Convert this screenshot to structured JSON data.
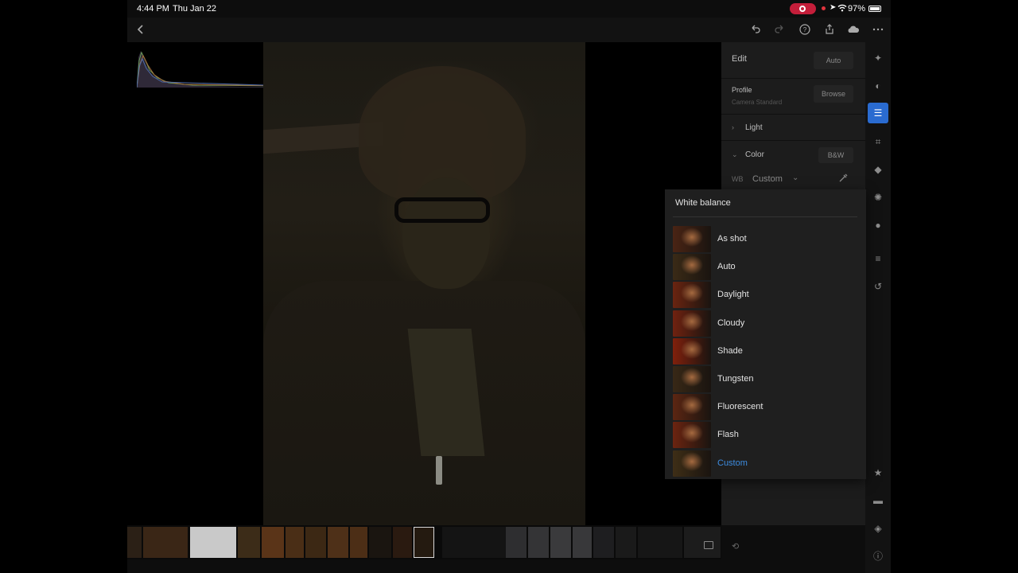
{
  "status_bar": {
    "time": "4:44 PM",
    "date": "Thu Jan 22",
    "battery": "97%"
  },
  "edit_panel": {
    "title": "Edit",
    "auto_button": "Auto",
    "profile_label": "Profile",
    "profile_value": "Camera Standard",
    "browse_button": "Browse",
    "light_label": "Light",
    "color_label": "Color",
    "bw_button": "B&W",
    "wb_label": "WB",
    "wb_value": "Custom"
  },
  "white_balance": {
    "title": "White balance",
    "options": [
      {
        "label": "As shot",
        "tint": "#4a2414"
      },
      {
        "label": "Auto",
        "tint": "#3a2a16"
      },
      {
        "label": "Daylight",
        "tint": "#6a2410"
      },
      {
        "label": "Cloudy",
        "tint": "#702210"
      },
      {
        "label": "Shade",
        "tint": "#80200c"
      },
      {
        "label": "Tungsten",
        "tint": "#382816"
      },
      {
        "label": "Fluorescent",
        "tint": "#5c2612"
      },
      {
        "label": "Flash",
        "tint": "#6c2410"
      },
      {
        "label": "Custom",
        "tint": "#3e2e16"
      }
    ],
    "selected": "Custom"
  },
  "colors": {
    "accent": "#2a6bd0",
    "selected_text": "#3d8ce0",
    "recording": "#c41e3a"
  }
}
